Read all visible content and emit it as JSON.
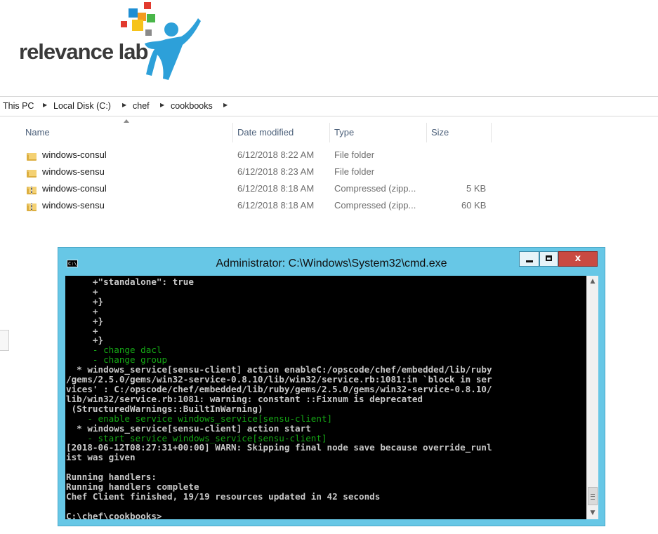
{
  "logo": {
    "text": "relevance lab"
  },
  "explorer": {
    "breadcrumb": [
      "This PC",
      "Local Disk (C:)",
      "chef",
      "cookbooks"
    ],
    "columns": [
      "Name",
      "Date modified",
      "Type",
      "Size"
    ],
    "files": [
      {
        "name": "windows-consul",
        "date": "6/12/2018 8:22 AM",
        "type": "File folder",
        "size": "",
        "icon": "folder-icon"
      },
      {
        "name": "windows-sensu",
        "date": "6/12/2018 8:23 AM",
        "type": "File folder",
        "size": "",
        "icon": "folder-icon"
      },
      {
        "name": "windows-consul",
        "date": "6/12/2018 8:18 AM",
        "type": "Compressed (zipp...",
        "size": "5 KB",
        "icon": "zip-folder-icon"
      },
      {
        "name": "windows-sensu",
        "date": "6/12/2018 8:18 AM",
        "type": "Compressed (zipp...",
        "size": "60 KB",
        "icon": "zip-folder-icon"
      }
    ]
  },
  "cmd": {
    "title": "Administrator: C:\\Windows\\System32\\cmd.exe",
    "buttons": {
      "minimize": "",
      "maximize": "",
      "close": "x"
    },
    "lines": [
      {
        "text": "     +\"standalone\": true",
        "style": "w"
      },
      {
        "text": "     +",
        "style": "w"
      },
      {
        "text": "     +}",
        "style": "w"
      },
      {
        "text": "     +",
        "style": "w"
      },
      {
        "text": "     +}",
        "style": "w"
      },
      {
        "text": "     +",
        "style": "w"
      },
      {
        "text": "     +}",
        "style": "w"
      },
      {
        "text": "     - change dacl",
        "style": "g"
      },
      {
        "text": "     - change group",
        "style": "g"
      },
      {
        "text": "  * windows_service[sensu-client] action enableC:/opscode/chef/embedded/lib/ruby",
        "style": "w"
      },
      {
        "text": "/gems/2.5.0/gems/win32-service-0.8.10/lib/win32/service.rb:1081:in `block in ser",
        "style": "w"
      },
      {
        "text": "vices' : C:/opscode/chef/embedded/lib/ruby/gems/2.5.0/gems/win32-service-0.8.10/",
        "style": "w"
      },
      {
        "text": "lib/win32/service.rb:1081: warning: constant ::Fixnum is deprecated",
        "style": "w"
      },
      {
        "text": " (StructuredWarnings::BuiltInWarning)",
        "style": "w"
      },
      {
        "text": "    - enable service windows_service[sensu-client]",
        "style": "g"
      },
      {
        "text": "  * windows_service[sensu-client] action start",
        "style": "w"
      },
      {
        "text": "    - start service windows_service[sensu-client]",
        "style": "g"
      },
      {
        "text": "[2018-06-12T08:27:31+00:00] WARN: Skipping final node save because override_runl",
        "style": "w"
      },
      {
        "text": "ist was given",
        "style": "w"
      },
      {
        "text": "",
        "style": "w"
      },
      {
        "text": "Running handlers:",
        "style": "w"
      },
      {
        "text": "Running handlers complete",
        "style": "w"
      },
      {
        "text": "Chef Client finished, 19/19 resources updated in 42 seconds",
        "style": "w"
      },
      {
        "text": "",
        "style": "w"
      },
      {
        "text": "C:\\chef\\cookbooks>",
        "style": "w"
      }
    ]
  }
}
